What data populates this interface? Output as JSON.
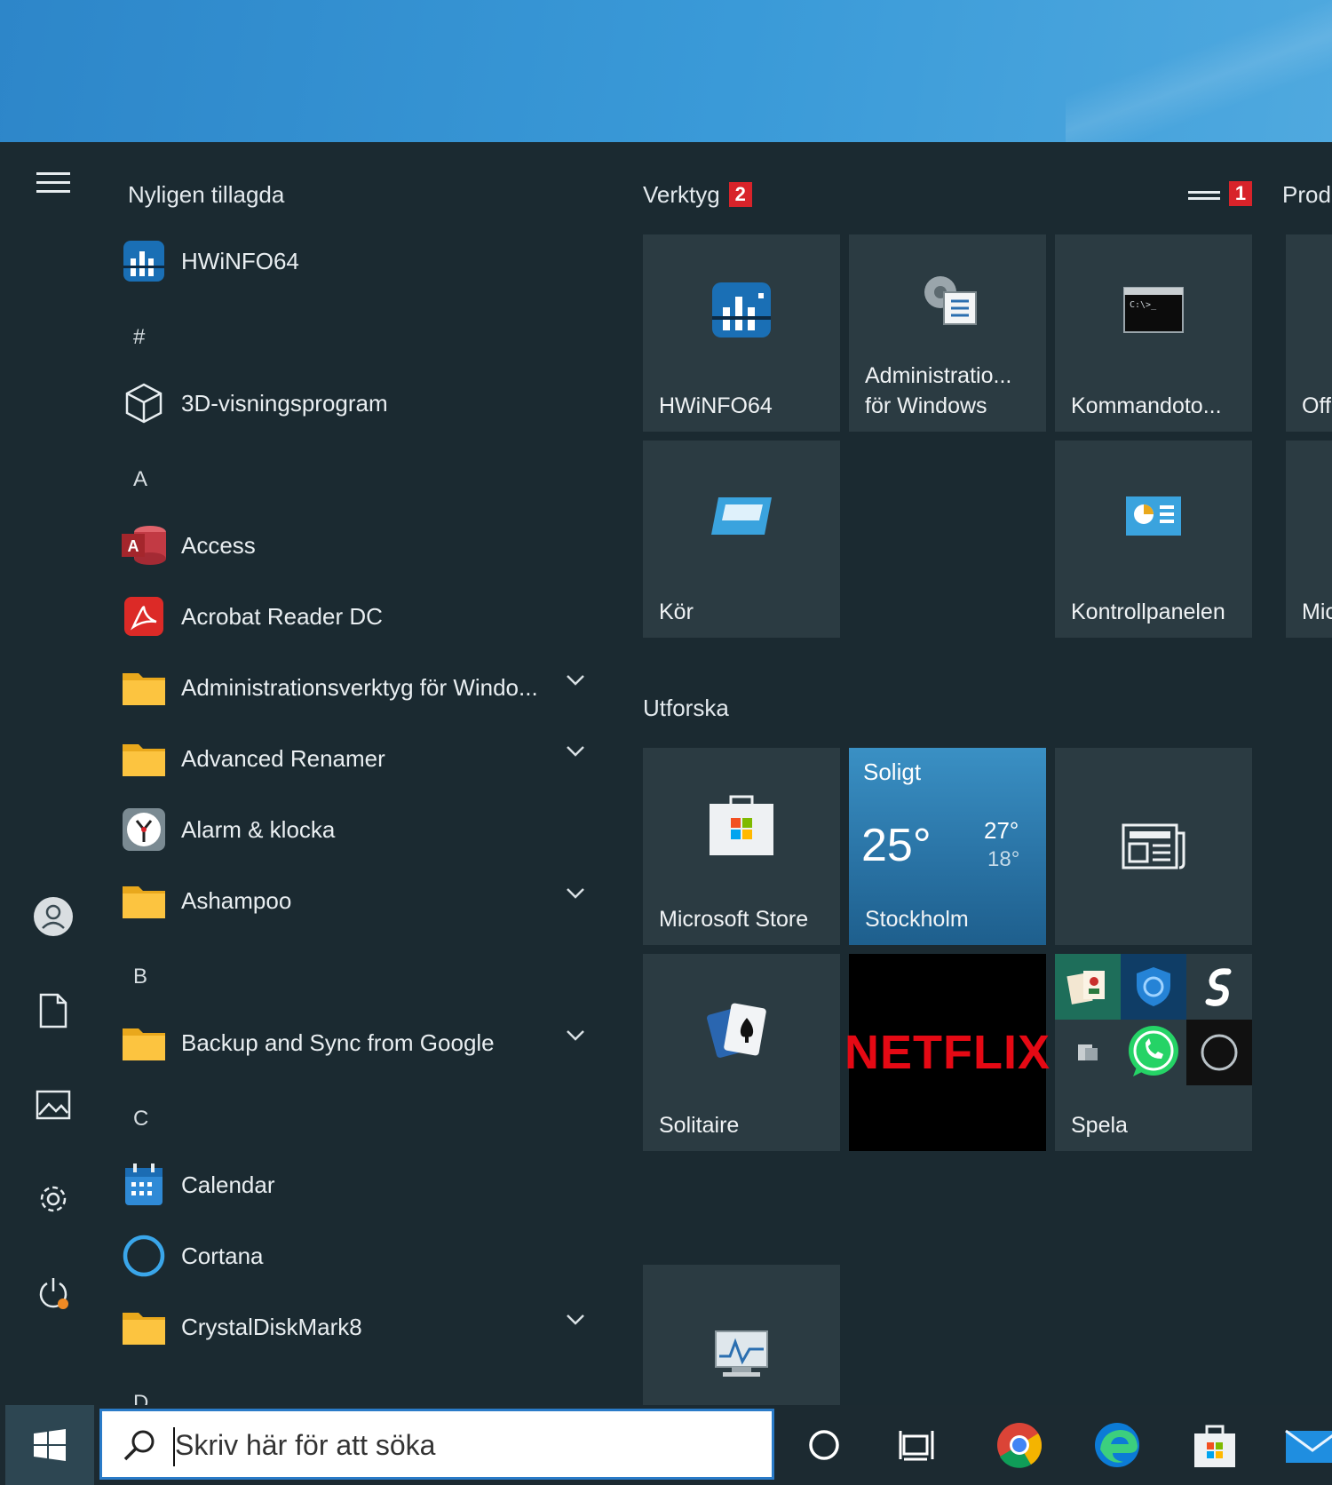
{
  "list": {
    "title": "Nyligen tillagda",
    "items": [
      {
        "label": "HWiNFO64"
      },
      {
        "label": "3D-visningsprogram"
      },
      {
        "label": "Access"
      },
      {
        "label": "Acrobat Reader DC"
      },
      {
        "label": "Administrationsverktyg för Windo..."
      },
      {
        "label": "Advanced Renamer"
      },
      {
        "label": "Alarm & klocka"
      },
      {
        "label": "Ashampoo"
      },
      {
        "label": "Backup and Sync from Google"
      },
      {
        "label": "Calendar"
      },
      {
        "label": "Cortana"
      },
      {
        "label": "CrystalDiskMark8"
      }
    ],
    "letters": [
      "#",
      "A",
      "B",
      "C",
      "D"
    ]
  },
  "groups": {
    "verktyg": {
      "title": "Verktyg",
      "badge": "2"
    },
    "right_badge": "1",
    "prod": {
      "title": "Prod"
    },
    "utforska": {
      "title": "Utforska"
    }
  },
  "tiles": {
    "hwinfo": "HWiNFO64",
    "admin_line1": "Administratio...",
    "admin_line2": "för Windows",
    "cmd": "Kommandoto...",
    "office": "Off",
    "run": "Kör",
    "control": "Kontrollpanelen",
    "mic": "Mic",
    "store": "Microsoft Store",
    "weather": {
      "condition": "Soligt",
      "temp": "25°",
      "high": "27°",
      "low": "18°",
      "city": "Stockholm"
    },
    "solitaire": "Solitaire",
    "netflix": "NETFLIX",
    "play": "Spela"
  },
  "taskbar": {
    "search_placeholder": "Skriv här för att söka"
  }
}
